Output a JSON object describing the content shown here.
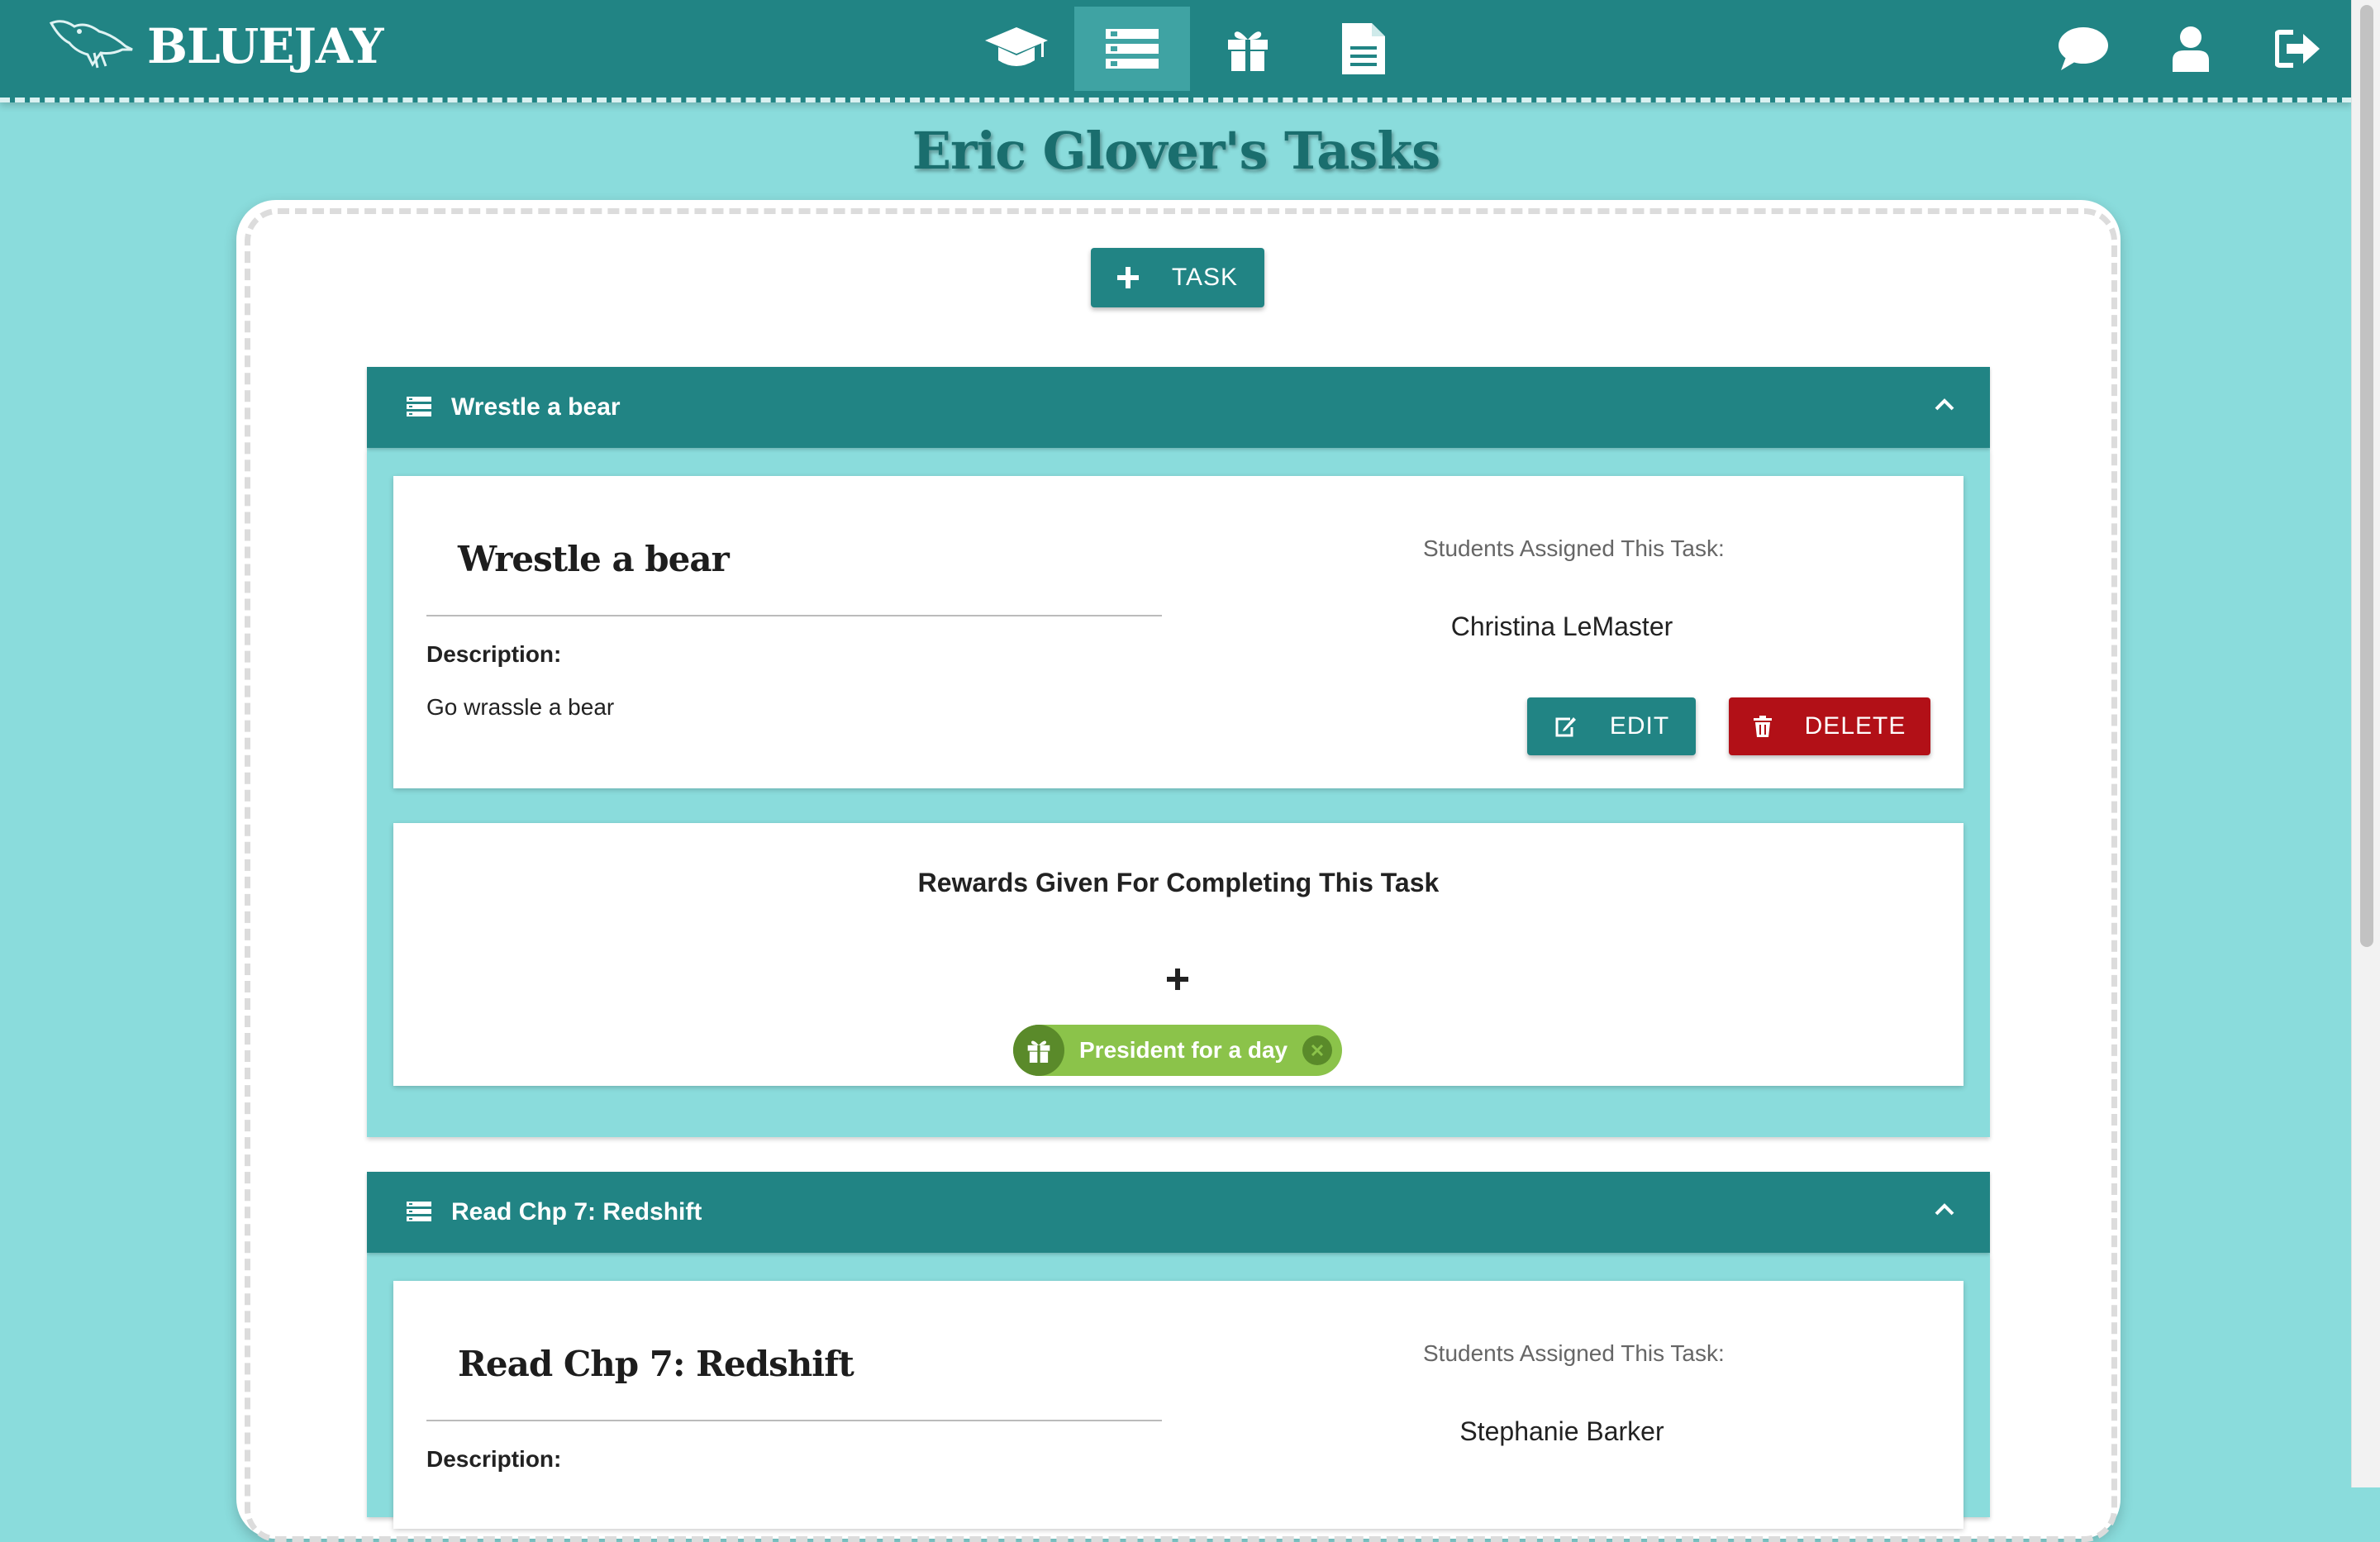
{
  "app": {
    "brand": "BLUEJAY"
  },
  "nav": {
    "center": [
      {
        "icon": "graduation-cap-icon",
        "active": false
      },
      {
        "icon": "tasks-list-icon",
        "active": true
      },
      {
        "icon": "gift-icon",
        "active": false
      },
      {
        "icon": "document-icon",
        "active": false
      }
    ],
    "right": [
      {
        "icon": "chat-bubble-icon"
      },
      {
        "icon": "user-icon"
      },
      {
        "icon": "sign-out-icon"
      }
    ]
  },
  "page": {
    "title": "Eric Glover's Tasks"
  },
  "toolbar": {
    "add_task_label": "TASK"
  },
  "tasks": [
    {
      "header": "Wrestle a bear",
      "title": "Wrestle a bear",
      "description_label": "Description:",
      "description": "Go wrassle a bear",
      "assigned_label": "Students Assigned This Task:",
      "students": [
        "Christina LeMaster"
      ],
      "edit_label": "EDIT",
      "delete_label": "DELETE",
      "rewards_title": "Rewards Given For Completing This Task",
      "add_reward_symbol": "+",
      "rewards": [
        "President for a day"
      ]
    },
    {
      "header": "Read Chp 7: Redshift",
      "title": "Read Chp 7: Redshift",
      "description_label": "Description:",
      "assigned_label": "Students Assigned This Task:",
      "students": [
        "Stephanie Barker"
      ]
    }
  ],
  "colors": {
    "background": "#8adcdc",
    "primary": "#218484",
    "danger": "#b21017",
    "reward": "#8bc34a"
  }
}
